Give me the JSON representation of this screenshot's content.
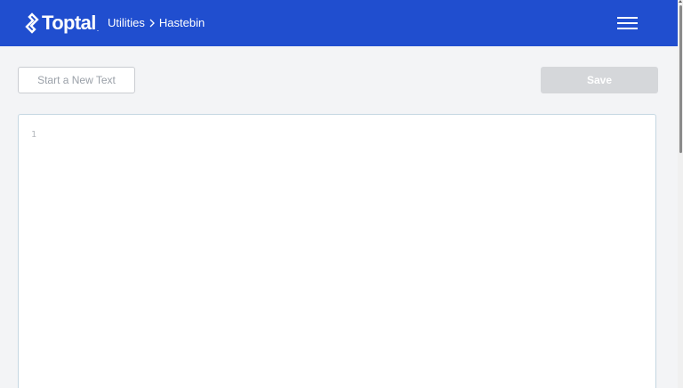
{
  "header": {
    "logo_text": "Toptal",
    "logo_trademark": ".",
    "breadcrumb": {
      "parent": "Utilities",
      "current": "Hastebin"
    },
    "menu_icon": "hamburger-menu-icon",
    "background_color": "#204ecf"
  },
  "toolbar": {
    "new_text_label": "Start a New Text",
    "save_label": "Save"
  },
  "editor": {
    "line_numbers": [
      "1"
    ],
    "content": ""
  }
}
